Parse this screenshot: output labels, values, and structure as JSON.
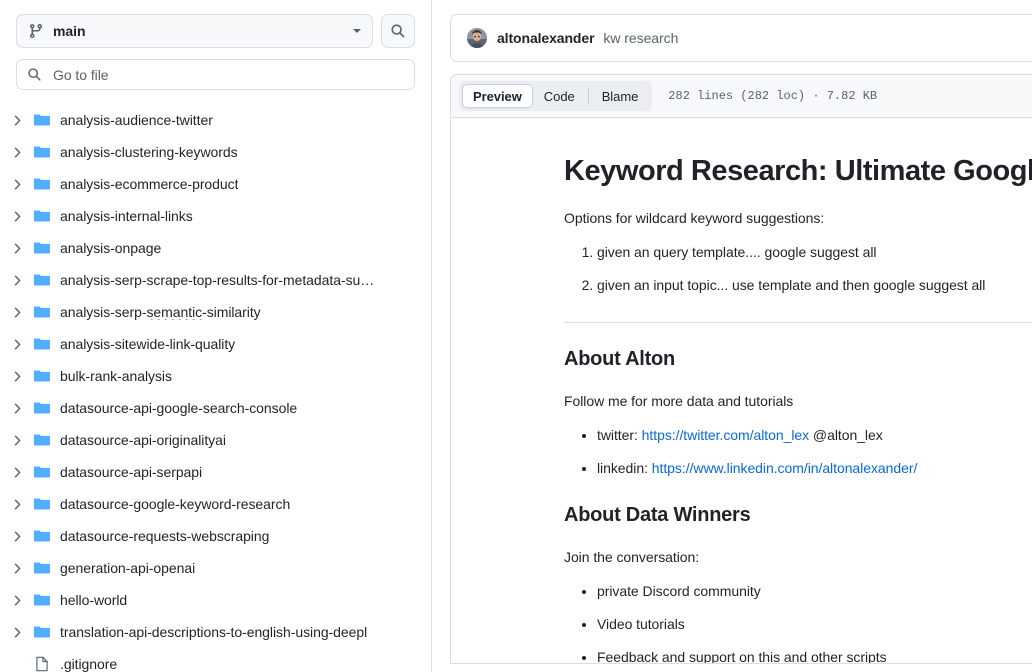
{
  "sidebar": {
    "branch": {
      "icon": "git-branch-icon",
      "label": "main",
      "caret": "chevron-down-icon"
    },
    "search_button_icon": "search-icon",
    "go_to_file": {
      "icon": "search-icon",
      "placeholder": "Go to file",
      "value": ""
    },
    "tree": [
      {
        "name": "analysis-audience-twitter",
        "type": "folder",
        "expanded": false
      },
      {
        "name": "analysis-clustering-keywords",
        "type": "folder",
        "expanded": false
      },
      {
        "name": "analysis-ecommerce-product",
        "type": "folder",
        "expanded": false
      },
      {
        "name": "analysis-internal-links",
        "type": "folder",
        "expanded": false
      },
      {
        "name": "analysis-onpage",
        "type": "folder",
        "expanded": false
      },
      {
        "name": "analysis-serp-scrape-top-results-for-metadata-su…",
        "type": "folder",
        "expanded": false
      },
      {
        "name": "analysis-serp-semantic-similarity",
        "type": "folder",
        "expanded": false,
        "spellcheck_word": "semantic"
      },
      {
        "name": "analysis-sitewide-link-quality",
        "type": "folder",
        "expanded": false
      },
      {
        "name": "bulk-rank-analysis",
        "type": "folder",
        "expanded": false
      },
      {
        "name": "datasource-api-google-search-console",
        "type": "folder",
        "expanded": false
      },
      {
        "name": "datasource-api-originalityai",
        "type": "folder",
        "expanded": false
      },
      {
        "name": "datasource-api-serpapi",
        "type": "folder",
        "expanded": false
      },
      {
        "name": "datasource-google-keyword-research",
        "type": "folder",
        "expanded": false
      },
      {
        "name": "datasource-requests-webscraping",
        "type": "folder",
        "expanded": false
      },
      {
        "name": "generation-api-openai",
        "type": "folder",
        "expanded": false
      },
      {
        "name": "hello-world",
        "type": "folder",
        "expanded": false
      },
      {
        "name": "translation-api-descriptions-to-english-using-deepl",
        "type": "folder",
        "expanded": false
      },
      {
        "name": ".gitignore",
        "type": "file"
      }
    ]
  },
  "main": {
    "breadcrumb": {
      "avatar": "user-avatar",
      "owner": "altonalexander",
      "repo": "kw research"
    },
    "file_header": {
      "tabs": [
        {
          "label": "Preview",
          "active": true
        },
        {
          "label": "Code",
          "active": false
        },
        {
          "label": "Blame",
          "active": false
        }
      ],
      "meta": "282 lines (282 loc) · 7.82 KB"
    },
    "document": {
      "title": "Keyword Research: Ultimate Google S",
      "intro": "Options for wildcard keyword suggestions:",
      "ordered_list": [
        "given an query template.... google suggest all",
        "given an input topic... use template and then google suggest all"
      ],
      "sections": [
        {
          "heading": "About Alton",
          "paragraph": "Follow me for more data and tutorials",
          "items": [
            {
              "prefix": "twitter: ",
              "link_text": "https://twitter.com/alton_lex",
              "suffix": " @alton_lex"
            },
            {
              "prefix": "linkedin: ",
              "link_text": "https://www.linkedin.com/in/altonalexander/",
              "suffix": ""
            }
          ]
        },
        {
          "heading": "About Data Winners",
          "paragraph": "Join the conversation:",
          "items": [
            {
              "prefix": "private Discord community",
              "link_text": "",
              "suffix": ""
            },
            {
              "prefix": "Video tutorials",
              "link_text": "",
              "suffix": ""
            },
            {
              "prefix": "Feedback and support on this and other scripts",
              "link_text": "",
              "suffix": ""
            }
          ]
        }
      ]
    }
  },
  "colors": {
    "folder_blue": "#54aeff",
    "link_blue": "#0969da",
    "border": "#d8dee4",
    "muted_text": "#59636e",
    "text": "#1f2328",
    "header_bg": "#f6f8fa",
    "spellcheck_red": "#e8552a"
  }
}
